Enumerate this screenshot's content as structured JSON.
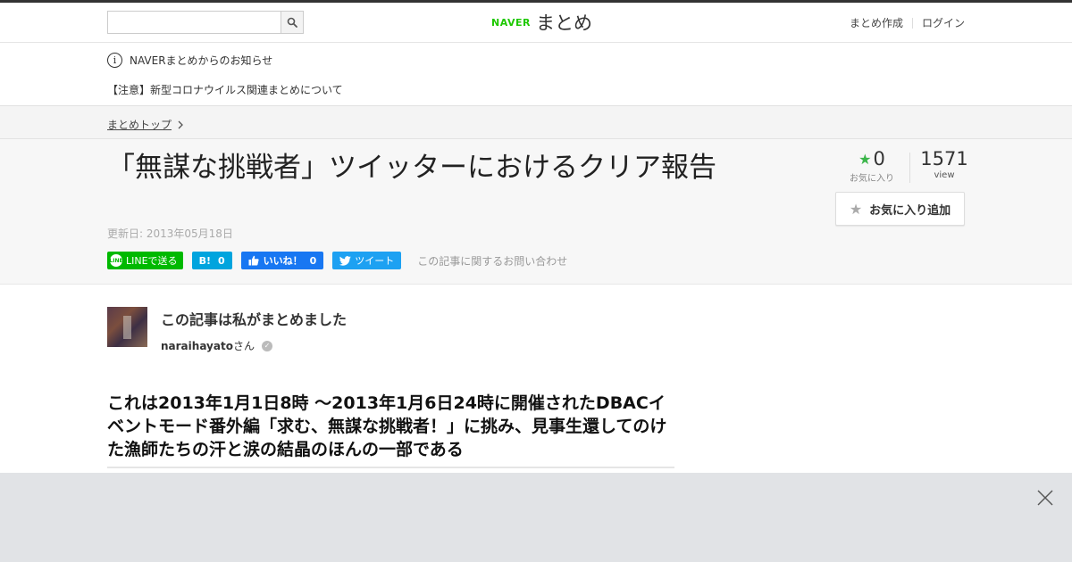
{
  "header": {
    "search_placeholder": "",
    "logo_naver": "NAVER",
    "logo_matome": "まとめ",
    "nav_create": "まとめ作成",
    "nav_login": "ログイン"
  },
  "notice": {
    "title": "NAVERまとめからのお知らせ",
    "item": "【注意】新型コロナウイルス関連まとめについて"
  },
  "breadcrumb": {
    "top": "まとめトップ"
  },
  "article": {
    "title": "「無謀な挑戦者」ツイッターにおけるクリア報告",
    "updated": "更新日: 2013年05月18日",
    "favorites_count": "0",
    "favorites_label": "お気に入り",
    "views_count": "1571",
    "views_label": "view",
    "add_favorite": "お気に入り追加",
    "contact": "この記事に関するお問い合わせ"
  },
  "share": {
    "line_badge": "LINE",
    "line_label": "LINEで送る",
    "hatena_label": "B!",
    "hatena_count": "0",
    "fb_label": "いいね！",
    "fb_count": "0",
    "tweet_label": "ツイート"
  },
  "author": {
    "title": "この記事は私がまとめました",
    "name": "naraihayato",
    "suffix": "さん"
  },
  "content": {
    "heading": "これは2013年1月1日8時 ～2013年1月6日24時に開催されたDBACイベントモード番外編「求む、無謀な挑戦者！」に挑み、見事生還してのけた漁師たちの汗と涙の結晶のほんの一部である"
  },
  "colors": {
    "naver_green": "#1ec800",
    "line_green": "#00b900",
    "hatena_blue": "#00a4de",
    "facebook_blue": "#1877f2",
    "twitter_blue": "#1da1f2",
    "star_green": "#3bb54a"
  }
}
